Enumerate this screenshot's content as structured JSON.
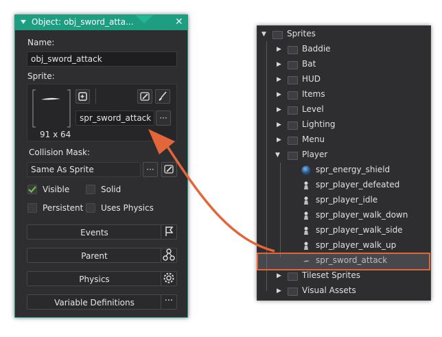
{
  "object_editor": {
    "title": "Object: obj_sword_atta...",
    "close_glyph": "✕",
    "name_label": "Name:",
    "name_value": "obj_sword_attack",
    "sprite_label": "Sprite:",
    "sprite_size": "91 x 64",
    "sprite_value": "spr_sword_attack",
    "more_glyph": "···",
    "collision_label": "Collision Mask:",
    "collision_value": "Same As Sprite",
    "checkboxes": [
      {
        "label": "Visible",
        "checked": true
      },
      {
        "label": "Solid",
        "checked": false
      },
      {
        "label": "Persistent",
        "checked": false
      },
      {
        "label": "Uses Physics",
        "checked": false
      }
    ],
    "buttons": {
      "events": "Events",
      "parent": "Parent",
      "physics": "Physics",
      "variable_definitions": "Variable Definitions"
    },
    "colors": {
      "accent": "#1d9e81",
      "highlight": "#e3663a",
      "check": "#6cc04a"
    }
  },
  "resource_tree": {
    "root": "Sprites",
    "groups": [
      "Baddie",
      "Bat",
      "HUD",
      "Items",
      "Level",
      "Lighting",
      "Menu"
    ],
    "open_group": "Player",
    "player_items": [
      {
        "name": "spr_energy_shield",
        "icon": "orb-icon"
      },
      {
        "name": "spr_player_defeated",
        "icon": "figure-icon"
      },
      {
        "name": "spr_player_idle",
        "icon": "figure-icon"
      },
      {
        "name": "spr_player_walk_down",
        "icon": "figure-icon"
      },
      {
        "name": "spr_player_walk_side",
        "icon": "figure-icon"
      },
      {
        "name": "spr_player_walk_up",
        "icon": "figure-icon"
      },
      {
        "name": "spr_sword_attack",
        "icon": "sword-icon"
      }
    ],
    "after_groups": [
      "Tileset Sprites",
      "Visual Assets"
    ]
  }
}
